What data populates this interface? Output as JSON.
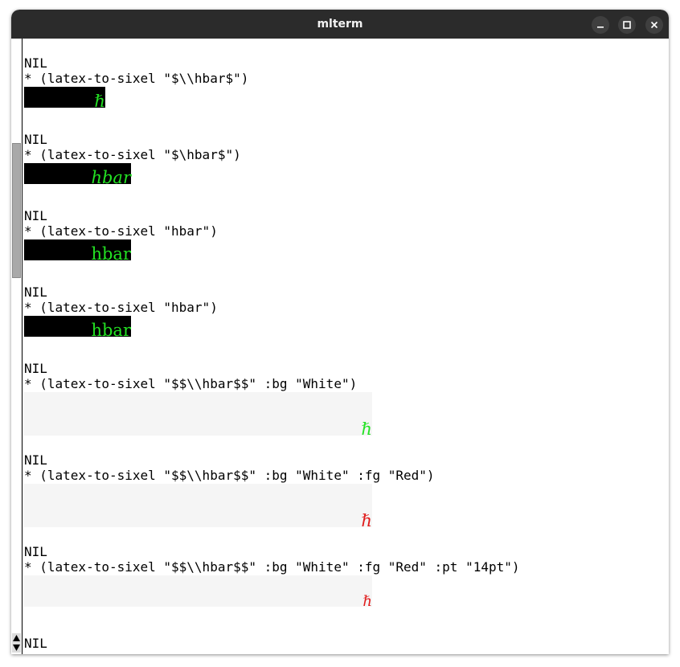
{
  "window": {
    "title": "mlterm",
    "controls": {
      "minimize": "minimize-icon",
      "maximize": "maximize-icon",
      "close": "close-icon"
    }
  },
  "colors": {
    "titlebar": "#2b2b2b",
    "green_glyph": "#23e223",
    "red_glyph": "#e01b1b",
    "white_bg": "#f5f5f5"
  },
  "terminal": {
    "lines": [
      "NIL",
      "* (latex-to-sixel \"$\\\\hbar$\")",
      "NIL",
      "* (latex-to-sixel \"$\\hbar$\")",
      "NIL",
      "* (latex-to-sixel \"hbar\")",
      "NIL",
      "* (latex-to-sixel \"hbar\")",
      "NIL",
      "* (latex-to-sixel \"$$\\\\hbar$$\" :bg \"White\")",
      "NIL",
      "* (latex-to-sixel \"$$\\\\hbar$$\" :bg \"White\" :fg \"Red\")",
      "NIL",
      "* (latex-to-sixel \"$$\\\\hbar$$\" :bg \"White\" :fg \"Red\" :pt \"14pt\")",
      "NIL"
    ],
    "images": [
      {
        "text": "ℏ",
        "bg": "black",
        "fg": "green"
      },
      {
        "text": "hbar",
        "bg": "black",
        "fg": "green"
      },
      {
        "text": "hbar",
        "bg": "black",
        "fg": "green"
      },
      {
        "text": "hbar",
        "bg": "black",
        "fg": "green"
      },
      {
        "text": "ℏ",
        "bg": "white",
        "fg": "green"
      },
      {
        "text": "ℏ",
        "bg": "white",
        "fg": "red"
      },
      {
        "text": "ℏ",
        "bg": "white",
        "fg": "red"
      }
    ]
  }
}
